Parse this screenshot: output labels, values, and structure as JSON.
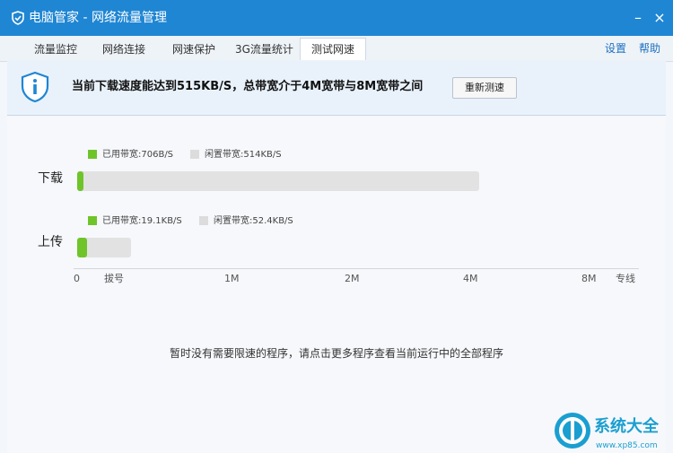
{
  "window": {
    "title": "电脑管家 - 网络流量管理",
    "minimize": "–",
    "close": "×"
  },
  "tabs": [
    {
      "label": "流量监控",
      "active": false
    },
    {
      "label": "网络连接",
      "active": false
    },
    {
      "label": "网速保护",
      "active": false
    },
    {
      "label": "3G流量统计",
      "active": false
    },
    {
      "label": "测试网速",
      "active": true
    }
  ],
  "top_links": {
    "settings": "设置",
    "help": "帮助"
  },
  "banner": {
    "message": "当前下载速度能达到515KB/S，总带宽介于4M宽带与8M宽带之间",
    "retest_button": "重新测速"
  },
  "download": {
    "label": "下载",
    "used_label": "已用带宽:706B/S",
    "free_label": "闲置带宽:514KB/S",
    "used_fraction": 0.015
  },
  "upload": {
    "label": "上传",
    "used_label": "已用带宽:19.1KB/S",
    "free_label": "闲置带宽:52.4KB/S",
    "used_fraction": 0.18
  },
  "axis": {
    "ticks": [
      "0",
      "拔号",
      "1M",
      "2M",
      "4M",
      "8M",
      "专线"
    ]
  },
  "status_message": "暂时没有需要限速的程序，请点击更多程序查看当前运行中的全部程序",
  "watermark": {
    "text": "系统大全",
    "url": "www.xp85.com"
  },
  "colors": {
    "titlebar": "#1f86d3",
    "used": "#6fc42a",
    "free": "#e2e2e2",
    "link": "#1c6fc1"
  }
}
